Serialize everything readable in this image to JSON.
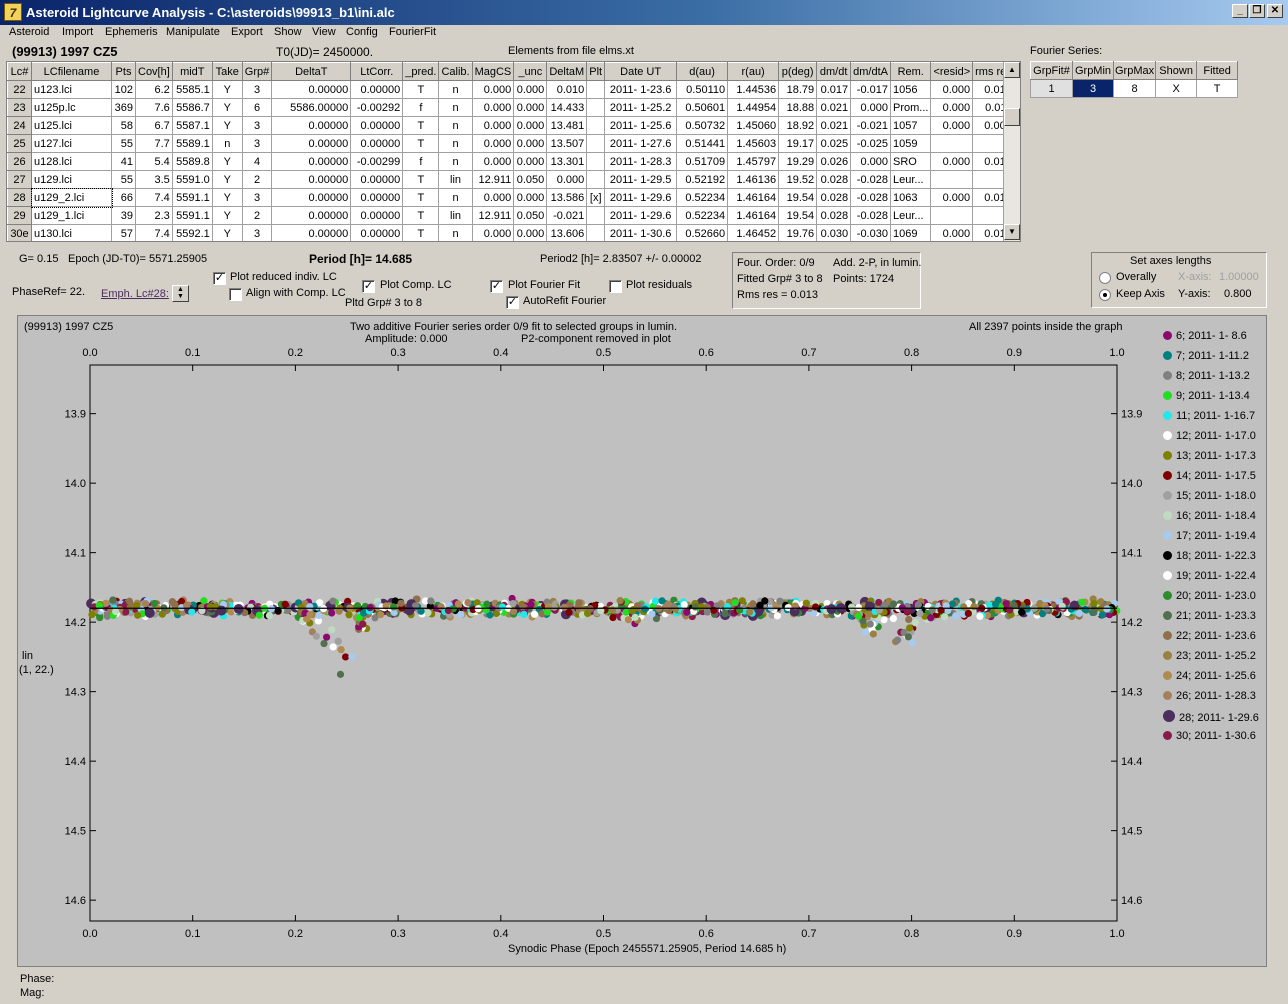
{
  "window": {
    "title": "Asteroid Lightcurve Analysis - C:\\asteroids\\99913_b1\\ini.alc",
    "icon_letter": "7"
  },
  "menu": [
    "Asteroid",
    "Import",
    "Ephemeris",
    "Manipulate",
    "Export",
    "Show",
    "View",
    "Config",
    "FourierFit"
  ],
  "header": {
    "object": "(99913) 1997 CZ5",
    "t0": "T0(JD)= 2450000.",
    "elements": "Elements from file elms.xt",
    "fourier_series": "Fourier Series:"
  },
  "table": {
    "columns": [
      "Lc#",
      "LCfilename",
      "Pts",
      "Cov[h]",
      "midT",
      "Take",
      "Grp#",
      "DeltaT",
      "LtCorr.",
      "_pred.",
      "Calib.",
      "MagCS",
      "_unc",
      "DeltaM",
      "Plt",
      "Date UT",
      "d(au)",
      "r(au)",
      "p(deg)",
      "dm/dt",
      "dm/dtA",
      "Rem.",
      "<resid>",
      "rms res"
    ],
    "rows": [
      [
        "22",
        "u123.lci",
        "102",
        "6.2",
        "5585.1",
        "Y",
        "3",
        "0.00000",
        "0.00000",
        "T",
        "n",
        "0.000",
        "0.000",
        "0.010",
        "",
        "2011- 1-23.6",
        "0.50110",
        "1.44536",
        "18.79",
        "0.017",
        "-0.017",
        "1056",
        "0.000",
        "0.013"
      ],
      [
        "23",
        "u125p.lc",
        "369",
        "7.6",
        "5586.7",
        "Y",
        "6",
        "5586.00000",
        "-0.00292",
        "f",
        "n",
        "0.000",
        "0.000",
        "14.433",
        "",
        "2011- 1-25.2",
        "0.50601",
        "1.44954",
        "18.88",
        "0.021",
        "0.000",
        "Prom...",
        "0.000",
        "0.011"
      ],
      [
        "24",
        "u125.lci",
        "58",
        "6.7",
        "5587.1",
        "Y",
        "3",
        "0.00000",
        "0.00000",
        "T",
        "n",
        "0.000",
        "0.000",
        "13.481",
        "",
        "2011- 1-25.6",
        "0.50732",
        "1.45060",
        "18.92",
        "0.021",
        "-0.021",
        "1057",
        "0.000",
        "0.009"
      ],
      [
        "25",
        "u127.lci",
        "55",
        "7.7",
        "5589.1",
        "n",
        "3",
        "0.00000",
        "0.00000",
        "T",
        "n",
        "0.000",
        "0.000",
        "13.507",
        "",
        "2011- 1-27.6",
        "0.51441",
        "1.45603",
        "19.17",
        "0.025",
        "-0.025",
        "1059",
        "",
        ""
      ],
      [
        "26",
        "u128.lci",
        "41",
        "5.4",
        "5589.8",
        "Y",
        "4",
        "0.00000",
        "-0.00299",
        "f",
        "n",
        "0.000",
        "0.000",
        "13.301",
        "",
        "2011- 1-28.3",
        "0.51709",
        "1.45797",
        "19.29",
        "0.026",
        "0.000",
        "SRO",
        "0.000",
        "0.015"
      ],
      [
        "27",
        "u129.lci",
        "55",
        "3.5",
        "5591.0",
        "Y",
        "2",
        "0.00000",
        "0.00000",
        "T",
        "lin",
        "12.911",
        "0.050",
        "0.000",
        "",
        "2011- 1-29.5",
        "0.52192",
        "1.46136",
        "19.52",
        "0.028",
        "-0.028",
        "Leur...",
        "",
        ""
      ],
      [
        "28",
        "u129_2.lci",
        "66",
        "7.4",
        "5591.1",
        "Y",
        "3",
        "0.00000",
        "0.00000",
        "T",
        "n",
        "0.000",
        "0.000",
        "13.586",
        "[x]",
        "2011- 1-29.6",
        "0.52234",
        "1.46164",
        "19.54",
        "0.028",
        "-0.028",
        "1063",
        "0.000",
        "0.014"
      ],
      [
        "29",
        "u129_1.lci",
        "39",
        "2.3",
        "5591.1",
        "Y",
        "2",
        "0.00000",
        "0.00000",
        "T",
        "lin",
        "12.911",
        "0.050",
        "-0.021",
        "",
        "2011- 1-29.6",
        "0.52234",
        "1.46164",
        "19.54",
        "0.028",
        "-0.028",
        "Leur...",
        "",
        ""
      ],
      [
        "30e",
        "u130.lci",
        "57",
        "7.4",
        "5592.1",
        "Y",
        "3",
        "0.00000",
        "0.00000",
        "T",
        "n",
        "0.000",
        "0.000",
        "13.606",
        "",
        "2011- 1-30.6",
        "0.52660",
        "1.46452",
        "19.76",
        "0.030",
        "-0.030",
        "1069",
        "0.000",
        "0.018"
      ]
    ]
  },
  "fourier_table": {
    "columns": [
      "GrpFit#",
      "GrpMin",
      "GrpMax",
      "Shown",
      "Fitted"
    ],
    "row": [
      "1",
      "3",
      "8",
      "X",
      "T"
    ]
  },
  "controls": {
    "g": "G= 0.15",
    "epoch": "Epoch (JD-T0)= 5571.25905",
    "period": "Period [h]= 14.685",
    "period2": "Period2 [h]= 2.83507 +/- 0.00002",
    "phaseref": "PhaseRef= 22.",
    "emph": "Emph. Lc#28:",
    "plot_reduced": "Plot reduced indiv. LC",
    "align": "Align with Comp. LC",
    "plot_comp": "Plot Comp. LC",
    "pltd_grp": "Pltd Grp#  3  to   8",
    "plot_fourier": "Plot Fourier Fit",
    "autorefit": "AutoRefit Fourier",
    "plot_resid": "Plot residuals",
    "four_order": "Four. Order:  0/9",
    "add2p": "Add. 2-P, in lumin.",
    "fitted_grp": "Fitted Grp# 3 to 8",
    "points": "Points: 1724",
    "rms": "Rms res    = 0.013",
    "axes_title": "Set axes lengths",
    "overally": "Overally",
    "keep_axis": "Keep Axis",
    "xaxis_lbl": "X-axis:",
    "xaxis_val": "1.00000",
    "yaxis_lbl": "Y-axis:",
    "yaxis_val": "0.800"
  },
  "plot": {
    "obj": "(99913) 1997 CZ5",
    "title1": "Two additive Fourier series order 0/9 fit to selected groups in lumin.",
    "title2": "Amplitude: 0.000",
    "title3": "P2-component removed in plot",
    "points_note": "All 2397 points inside the graph",
    "ylabel1": "lin",
    "ylabel2": "(1, 22.)",
    "xlabel": "Synodic Phase (Epoch 2455571.25905, Period 14.685 h)",
    "phase": "Phase:",
    "mag": "Mag:"
  },
  "chart_data": {
    "type": "scatter",
    "x_ticks": [
      "0.0",
      "0.1",
      "0.2",
      "0.3",
      "0.4",
      "0.5",
      "0.6",
      "0.7",
      "0.8",
      "0.9",
      "1.0"
    ],
    "y_ticks": [
      "13.9",
      "14.0",
      "14.1",
      "14.2",
      "14.3",
      "14.4",
      "14.5",
      "14.6"
    ],
    "xlim": [
      0,
      1
    ],
    "ylim": [
      13.83,
      14.63
    ],
    "fit_line_y": 14.18,
    "series": [
      {
        "name": "6; 2011- 1- 8.6",
        "color": "#8b0a6e"
      },
      {
        "name": "7; 2011- 1-11.2",
        "color": "#008080"
      },
      {
        "name": "8; 2011- 1-13.2",
        "color": "#808080"
      },
      {
        "name": "9; 2011- 1-13.4",
        "color": "#22dd22"
      },
      {
        "name": "11; 2011- 1-16.7",
        "color": "#22e8e8"
      },
      {
        "name": "12; 2011- 1-17.0",
        "color": "#ffffff"
      },
      {
        "name": "13; 2011- 1-17.3",
        "color": "#808000"
      },
      {
        "name": "14; 2011- 1-17.5",
        "color": "#800000"
      },
      {
        "name": "15; 2011- 1-18.0",
        "color": "#a0a0a0"
      },
      {
        "name": "16; 2011- 1-18.4",
        "color": "#c0dcc0"
      },
      {
        "name": "17; 2011- 1-19.4",
        "color": "#a6caf0"
      },
      {
        "name": "18; 2011- 1-22.3",
        "color": "#000000"
      },
      {
        "name": "19; 2011- 1-22.4",
        "color": "#ffffff"
      },
      {
        "name": "20; 2011- 1-23.0",
        "color": "#2e8b2e"
      },
      {
        "name": "21; 2011- 1-23.3",
        "color": "#507050"
      },
      {
        "name": "22; 2011- 1-23.6",
        "color": "#906f4c"
      },
      {
        "name": "23; 2011- 1-25.2",
        "color": "#9c8040"
      },
      {
        "name": "24; 2011- 1-25.6",
        "color": "#b08a50"
      },
      {
        "name": "26; 2011- 1-28.3",
        "color": "#a6805a"
      },
      {
        "name": "28; 2011- 1-29.6",
        "color": "#4b2d5e"
      },
      {
        "name": "30; 2011- 1-30.6",
        "color": "#8b1a4a"
      }
    ]
  }
}
